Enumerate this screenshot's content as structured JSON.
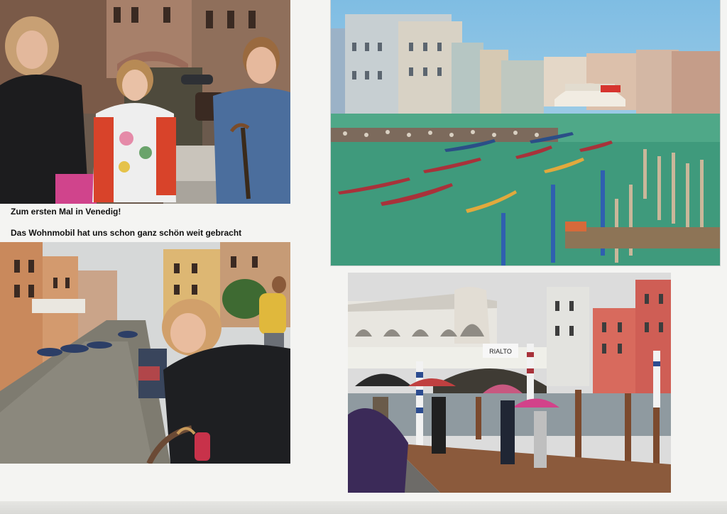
{
  "captions": {
    "line1": "Zum ersten Mal in Venedig!",
    "line2": "Das Wohnmobil  hat uns schon ganz schön weit gebracht"
  },
  "photos": [
    {
      "id": "family-by-canal-bridge",
      "position": "top-left"
    },
    {
      "id": "regatta-gondolas-rialto",
      "position": "top-right"
    },
    {
      "id": "woman-leaning-over-canal",
      "position": "bottom-left"
    },
    {
      "id": "rialto-bridge-umbrellas",
      "position": "bottom-right"
    }
  ],
  "signage": {
    "rialto_sign": "RIALTO"
  },
  "colors": {
    "album_page": "#f4f4f2",
    "canal_green": "#3f9a7c",
    "sky_blue": "#8ec5e6",
    "gondola_red": "#a8323a"
  }
}
